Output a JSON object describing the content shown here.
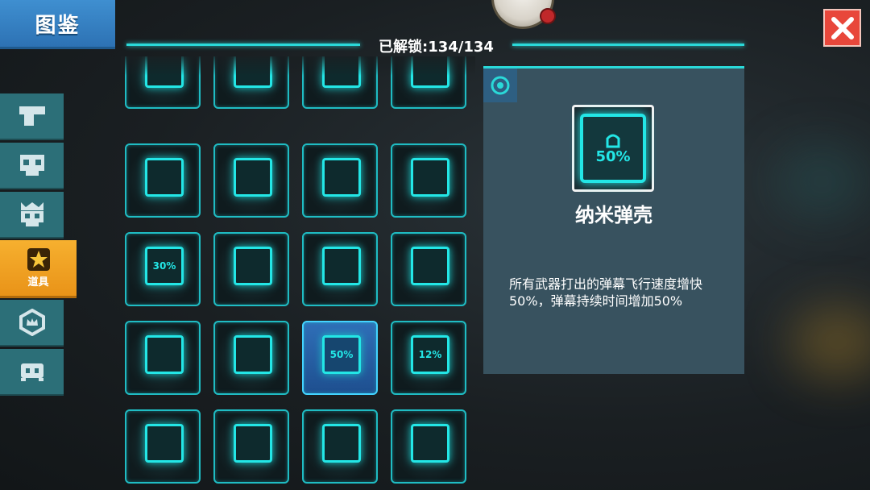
{
  "title": "图鉴",
  "unlock_status": "已解锁:134/134",
  "close_icon": "close-icon",
  "side_tabs": [
    {
      "icon": "pistol-icon",
      "label": ""
    },
    {
      "icon": "skull-icon",
      "label": ""
    },
    {
      "icon": "crowned-skull-icon",
      "label": ""
    },
    {
      "icon": "star-icon",
      "label": "道具",
      "active": true
    },
    {
      "icon": "crown-badge-icon",
      "label": ""
    },
    {
      "icon": "ghost-icon",
      "label": ""
    }
  ],
  "items": [
    {
      "icon": "bullets-icon",
      "text": ""
    },
    {
      "icon": "crosshair-x-icon",
      "text": ""
    },
    {
      "icon": "crosshair-heart-icon",
      "text": ""
    },
    {
      "icon": "crosshair-dashed-icon",
      "text": ""
    },
    {
      "icon": "shuriken-icon",
      "text": ""
    },
    {
      "icon": "heart-cross-icon",
      "text": ""
    },
    {
      "icon": "radiation-icon",
      "text": ""
    },
    {
      "icon": "x-circle-icon",
      "text": ""
    },
    {
      "icon": "arrow-up-icon",
      "text": "30%"
    },
    {
      "icon": "circle-arrow-up-icon",
      "text": ""
    },
    {
      "icon": "broken-heart-icon",
      "text": ""
    },
    {
      "icon": "heart-target-icon",
      "text": ""
    },
    {
      "icon": "crossed-swords-icon",
      "text": ""
    },
    {
      "icon": "crossed-guns-icon",
      "text": ""
    },
    {
      "icon": "shell-icon",
      "text": "50%",
      "selected": true
    },
    {
      "icon": "crossed-swords-icon",
      "text": "12%"
    },
    {
      "icon": "heart-shield-icon",
      "text": ""
    },
    {
      "icon": "ammo-clip-icon",
      "text": ""
    },
    {
      "icon": "stacked-bullets-icon",
      "text": ""
    },
    {
      "icon": "dice-icon",
      "text": ""
    }
  ],
  "detail": {
    "icon": "nano-shell-icon",
    "icon_text": "50%",
    "name": "纳米弹壳",
    "description": "所有武器打出的弹幕飞行速度增快50%，弹幕持续时间增加50%"
  },
  "colors": {
    "accent": "#23e6e6",
    "title_tab": "#3f8fd0",
    "active_tab": "#f6b02f",
    "close": "#e8473b",
    "panel": "#38525f"
  }
}
